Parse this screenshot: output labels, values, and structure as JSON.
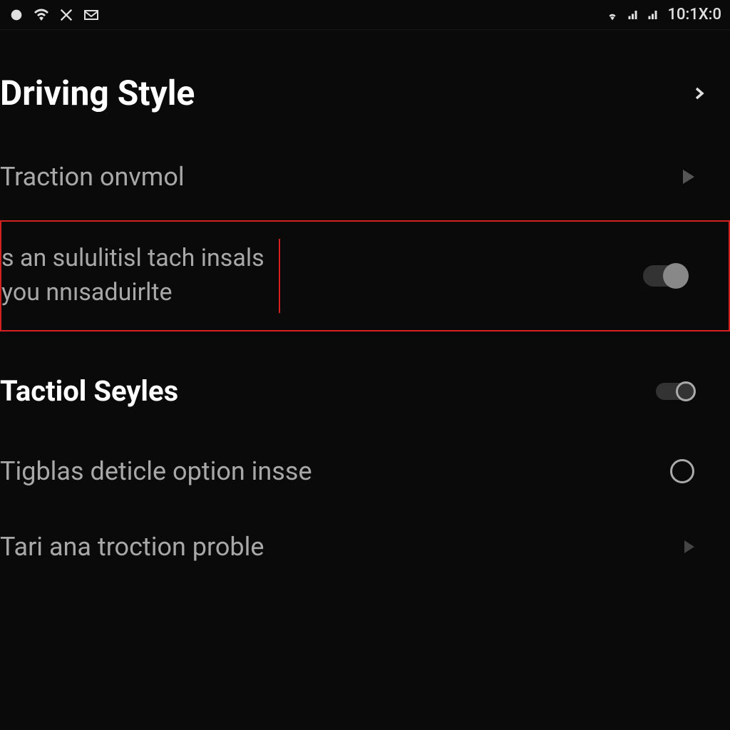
{
  "statusBar": {
    "time": "10:1X:0"
  },
  "header": {
    "title": "Driving Style"
  },
  "rows": {
    "traction": {
      "label": "Traction onvmol"
    },
    "highlighted": {
      "line1": "s an sululitisl tach insals",
      "line2": "you nnısaduirlte"
    },
    "tactiol": {
      "label": "Tactiol Seyles"
    },
    "tigblas": {
      "label": "Tigblas deticle option insse"
    },
    "tari": {
      "label": "Tari ana troction proble"
    }
  }
}
